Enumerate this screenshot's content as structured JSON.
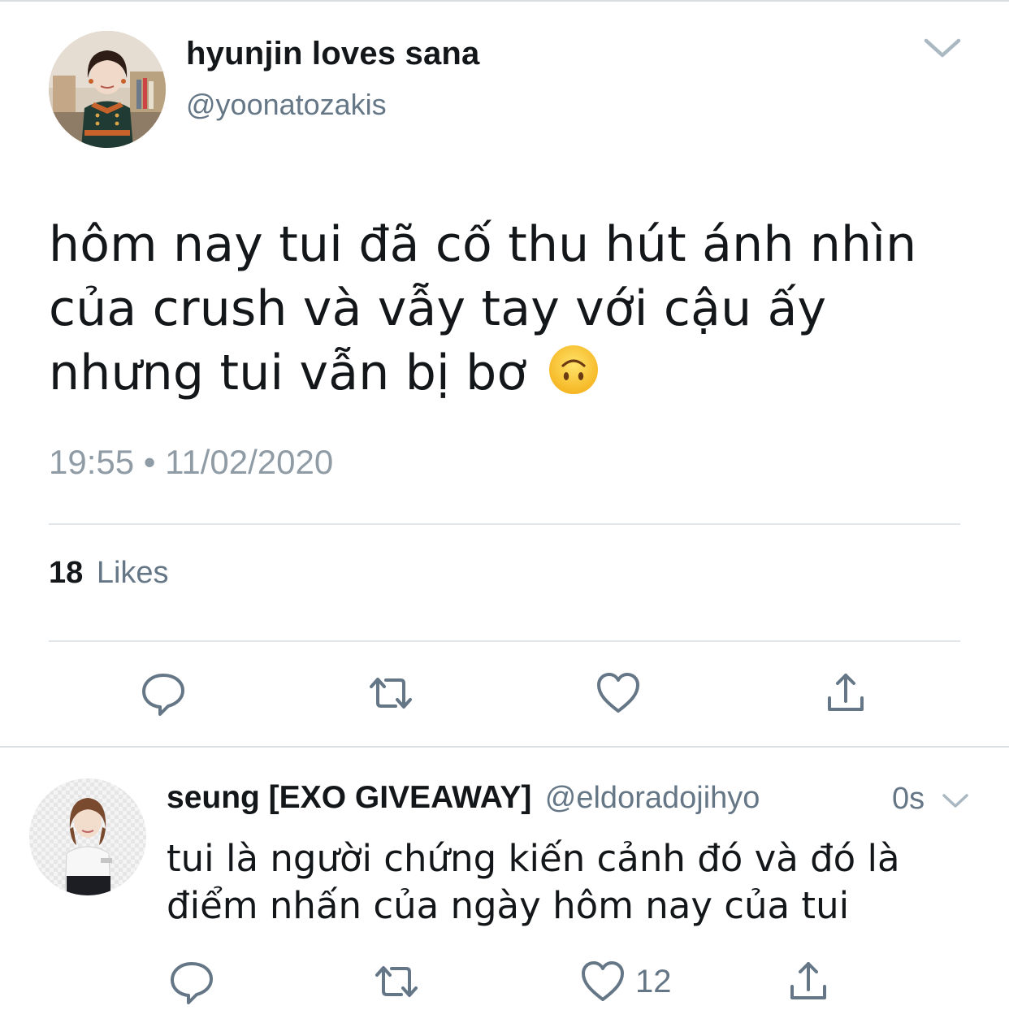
{
  "tweet": {
    "display_name": "hyunjin loves sana",
    "handle": "@yoonatozakis",
    "text": "hôm nay tui đã cố thu hút ánh nhìn của crush và vẫy tay với cậu ấy nhưng tui vẫn bị bơ",
    "emoji": "upside-down-face-emoji",
    "timestamp": "19:55 • 11/02/2020",
    "likes_count": "18",
    "likes_label": "Likes",
    "actions": [
      "reply-icon",
      "retweet-icon",
      "like-icon",
      "share-icon"
    ]
  },
  "reply": {
    "display_name": "seung [EXO GIVEAWAY]",
    "handle": "@eldoradojihyo",
    "time": "0s",
    "text": "tui là người chứng kiến cảnh đó và đó là điểm nhấn của ngày hôm nay của tui",
    "like_count": "12",
    "actions": [
      "reply-icon",
      "retweet-icon",
      "like-icon",
      "share-icon"
    ]
  },
  "colors": {
    "text_primary": "#14171a",
    "text_secondary": "#657786",
    "icon_gray": "#657786",
    "divider": "#e1e6ea",
    "background": "#ffffff"
  }
}
